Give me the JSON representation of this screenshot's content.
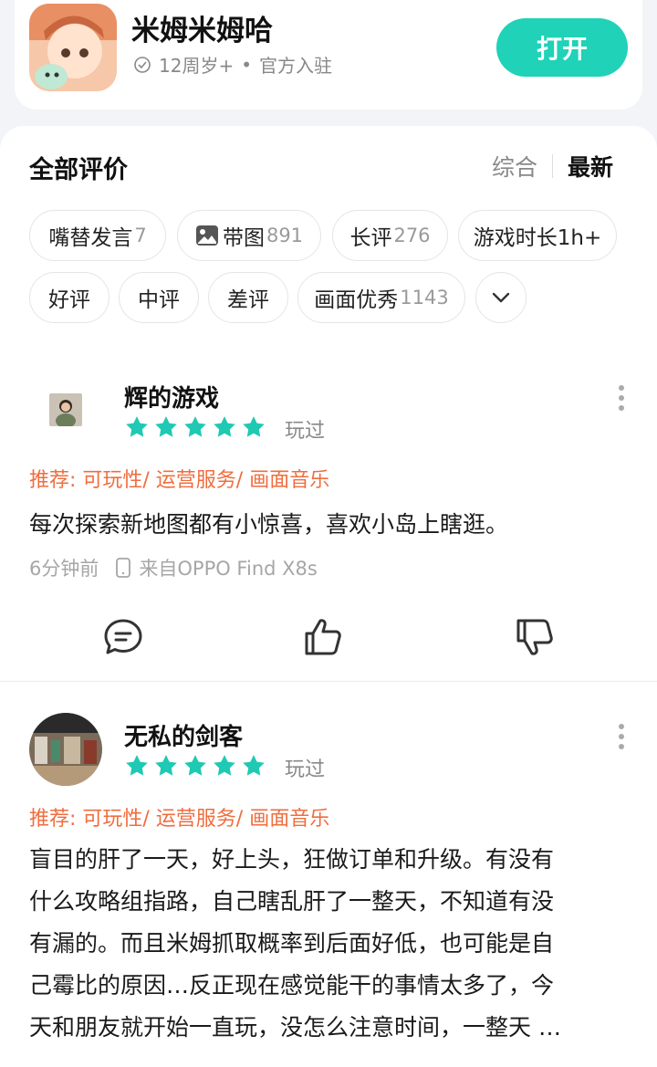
{
  "app": {
    "name": "米姆米姆哈",
    "age_rating": "12周岁+",
    "tag": "官方入驻",
    "separator": "•",
    "open_label": "打开"
  },
  "reviews_section": {
    "title": "全部评价",
    "sort_options": [
      "综合",
      "最新"
    ],
    "selected_sort": "最新"
  },
  "filters": [
    {
      "label": "嘴替发言",
      "count": "7"
    },
    {
      "label": "带图",
      "count": "891",
      "icon": "image-icon"
    },
    {
      "label": "长评",
      "count": "276"
    },
    {
      "label": "游戏时长1h+",
      "count": ""
    },
    {
      "label": "好评",
      "count": ""
    },
    {
      "label": "中评",
      "count": ""
    },
    {
      "label": "差评",
      "count": ""
    },
    {
      "label": "画面优秀",
      "count": "1143"
    }
  ],
  "reviews": [
    {
      "user": "辉的游戏",
      "rating": 5,
      "status": "玩过",
      "recommend": "推荐: 可玩性/ 运营服务/ 画面音乐",
      "content": "每次探索新地图都有小惊喜，喜欢小岛上瞎逛。",
      "time": "6分钟前",
      "device": "来自OPPO Find X8s"
    },
    {
      "user": "无私的剑客",
      "rating": 5,
      "status": "玩过",
      "recommend": "推荐: 可玩性/ 运营服务/ 画面音乐",
      "content_lines": [
        "盲目的肝了一天，好上头，狂做订单和升级。有没有",
        "什么攻略组指路，自己瞎乱肝了一整天，不知道有没",
        "有漏的。而且米姆抓取概率到后面好低，也可能是自",
        "己霉比的原因…反正现在感觉能干的事情太多了，今",
        "天和朋友就开始一直玩，没怎么注意时间，一整天 …"
      ]
    }
  ],
  "colors": {
    "accent": "#1fd2b8",
    "star": "#1fc9b3",
    "recommend": "#f06d3e"
  }
}
